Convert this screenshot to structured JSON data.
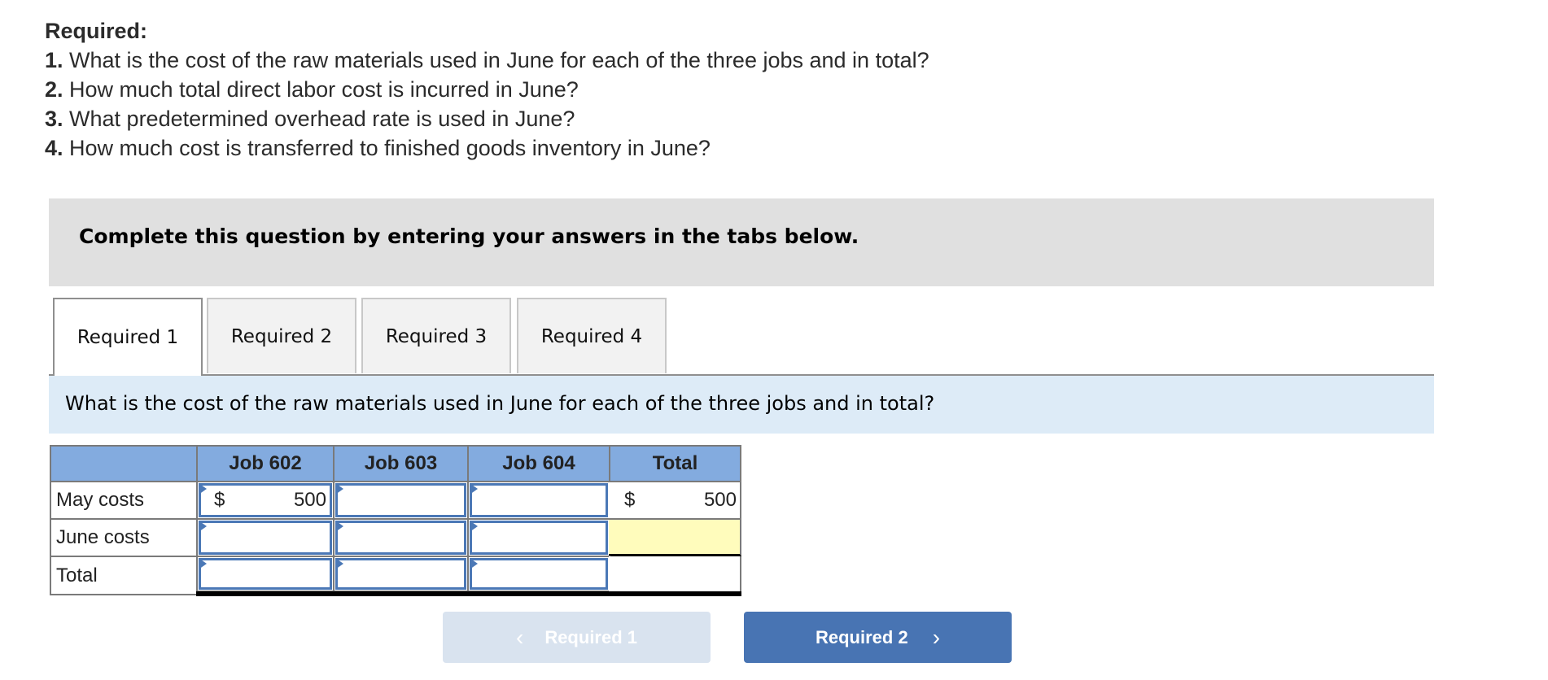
{
  "required": {
    "title": "Required:",
    "items": [
      {
        "num": "1.",
        "text": " What is the cost of the raw materials used in June for each of the three jobs and in total?"
      },
      {
        "num": "2.",
        "text": " How much total direct labor cost is incurred in June?"
      },
      {
        "num": "3.",
        "text": " What predetermined overhead rate is used in June?"
      },
      {
        "num": "4.",
        "text": " How much cost is transferred to finished goods inventory in June?"
      }
    ]
  },
  "banner": {
    "text": "Complete this question by entering your answers in the tabs below."
  },
  "tabs": [
    {
      "label": "Required 1",
      "active": true
    },
    {
      "label": "Required 2",
      "active": false
    },
    {
      "label": "Required 3",
      "active": false
    },
    {
      "label": "Required 4",
      "active": false
    }
  ],
  "question": {
    "text": "What is the cost of the raw materials used in June for each of the three jobs and in total?"
  },
  "table": {
    "columns": [
      "",
      "Job 602",
      "Job 603",
      "Job 604",
      "Total"
    ],
    "rows": [
      {
        "label": "May costs",
        "cells": [
          {
            "currency": "$",
            "value": "500"
          },
          {
            "currency": "",
            "value": ""
          },
          {
            "currency": "",
            "value": ""
          },
          {
            "currency": "$",
            "value": "500"
          }
        ]
      },
      {
        "label": "June costs",
        "cells": [
          {
            "currency": "",
            "value": ""
          },
          {
            "currency": "",
            "value": ""
          },
          {
            "currency": "",
            "value": ""
          },
          {
            "currency": "",
            "value": ""
          }
        ]
      },
      {
        "label": "Total",
        "cells": [
          {
            "currency": "",
            "value": ""
          },
          {
            "currency": "",
            "value": ""
          },
          {
            "currency": "",
            "value": ""
          },
          {
            "currency": "",
            "value": ""
          }
        ]
      }
    ]
  },
  "nav": {
    "prev_label": "Required 1",
    "next_label": "Required 2",
    "prev_icon": "chevron-left-icon",
    "next_icon": "chevron-right-icon",
    "prev_chevron": "‹",
    "next_chevron": "›"
  },
  "colors": {
    "header_blue": "#83abdf",
    "input_border": "#4b78b6",
    "highlight_yellow": "#fffcbc",
    "next_button": "#4874b3",
    "prev_button_disabled": "#d9e3ef"
  }
}
